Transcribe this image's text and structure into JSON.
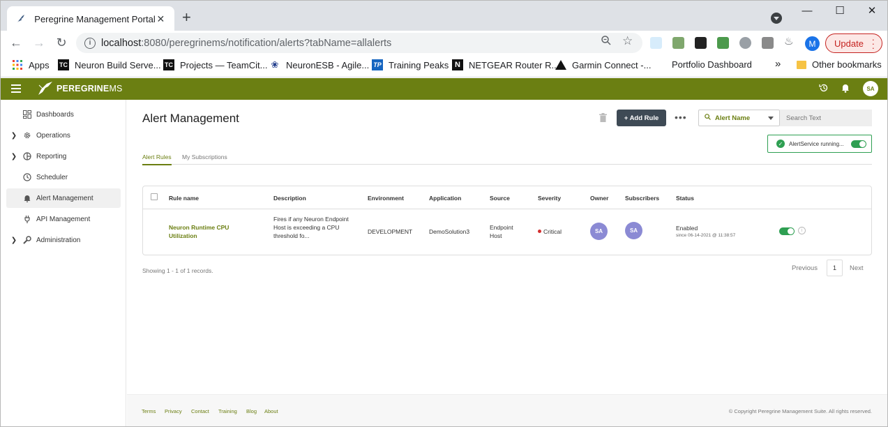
{
  "browser": {
    "tab_title": "Peregrine Management Portal",
    "tab_close": "✕",
    "new_tab": "+",
    "url_host": "localhost",
    "url_rest": ":8080/peregrinems/notification/alerts?tabName=allalerts",
    "profile_initial": "M",
    "update_label": "Update",
    "bookmarks": [
      {
        "label": "Apps"
      },
      {
        "label": "Neuron Build Serve..."
      },
      {
        "label": "Projects — TeamCit..."
      },
      {
        "label": "NeuronESB - Agile..."
      },
      {
        "label": "Training Peaks"
      },
      {
        "label": "NETGEAR Router R..."
      },
      {
        "label": "Garmin Connect -..."
      },
      {
        "label": "Portfolio Dashboard"
      }
    ],
    "bookmarks_overflow": "»",
    "other_bookmarks": "Other bookmarks"
  },
  "app": {
    "logo_bold": "PEREGRINE",
    "logo_thin": "MS",
    "user_initials": "SA"
  },
  "sidebar": {
    "items": [
      {
        "label": "Dashboards",
        "icon": "dashboard-icon"
      },
      {
        "label": "Operations",
        "icon": "gear-icon"
      },
      {
        "label": "Reporting",
        "icon": "chart-pie-icon"
      },
      {
        "label": "Scheduler",
        "icon": "clock-icon"
      },
      {
        "label": "Alert Management",
        "icon": "bell-icon"
      },
      {
        "label": "API Management",
        "icon": "plug-icon"
      },
      {
        "label": "Administration",
        "icon": "wrench-icon"
      }
    ]
  },
  "main": {
    "title": "Alert Management",
    "add_rule": "+ Add Rule",
    "more": "•••",
    "filter_label": "Alert Name",
    "search_placeholder": "Search Text",
    "service_status": "AlertService running...",
    "tabs": [
      {
        "label": "Alert Rules"
      },
      {
        "label": "My Subscriptions"
      }
    ],
    "columns": [
      "Rule name",
      "Description",
      "Environment",
      "Application",
      "Source",
      "Severity",
      "Owner",
      "Subscribers",
      "Status"
    ],
    "rows": [
      {
        "rule_name": "Neuron Runtime CPU Utilization",
        "description": "Fires if any Neuron Endpoint Host is exceeding a CPU threshold fo...",
        "environment": "DEVELOPMENT",
        "application": "DemoSolution3",
        "source": "Endpoint Host",
        "severity": "Critical",
        "owner": "SA",
        "subscribers": "SA",
        "status": "Enabled",
        "status_since": "since 06-14-2021 @ 11:38:57"
      }
    ],
    "records_text": "Showing 1 - 1 of 1 records.",
    "pager": {
      "previous": "Previous",
      "page": "1",
      "next": "Next"
    }
  },
  "footer": {
    "links": [
      "Terms",
      "Privacy",
      "Contact",
      "Training",
      "Blog",
      "About"
    ],
    "copyright": "© Copyright Peregrine Management Suite. All rights reserved."
  },
  "colors": {
    "brand": "#6b7f12",
    "status_green": "#2e9f52",
    "critical_red": "#d32f2f",
    "avatar_purple": "#8b8ad4",
    "button_dark": "#3e4a55"
  }
}
